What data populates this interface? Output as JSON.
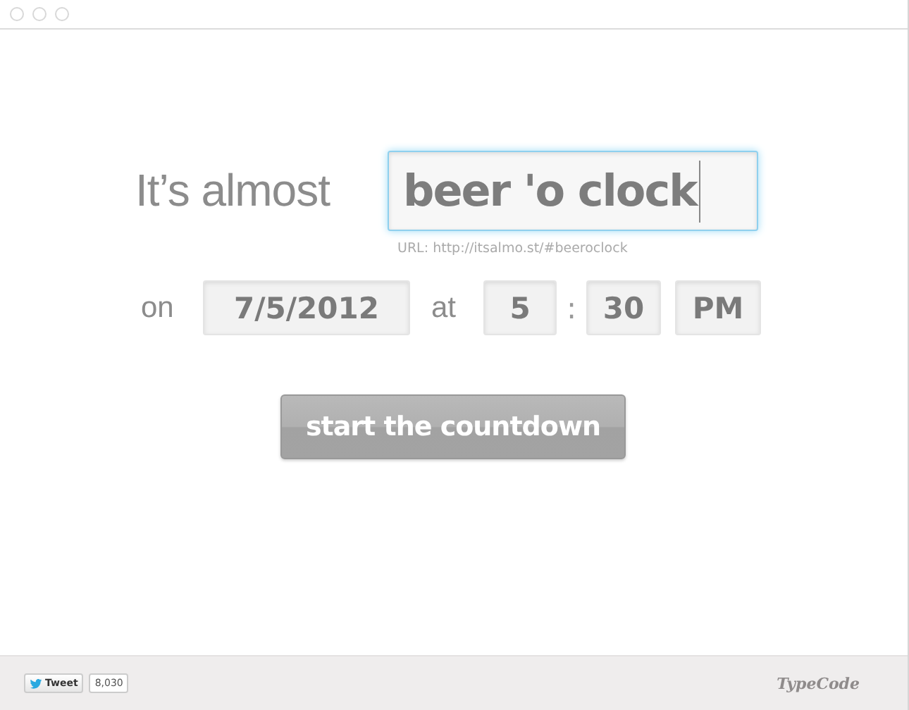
{
  "headline": {
    "lead": "It’s almost",
    "event_value": "beer 'o clock",
    "url_hint": "URL: http://itsalmo.st/#beeroclock"
  },
  "when": {
    "on_label": "on",
    "date": "7/5/2012",
    "at_label": "at",
    "hour": "5",
    "separator": ":",
    "minute": "30",
    "meridiem": "PM"
  },
  "start_button": "start the countdown",
  "footer": {
    "tweet_label": "Tweet",
    "tweet_count": "8,030",
    "logo": "TypeCode"
  }
}
